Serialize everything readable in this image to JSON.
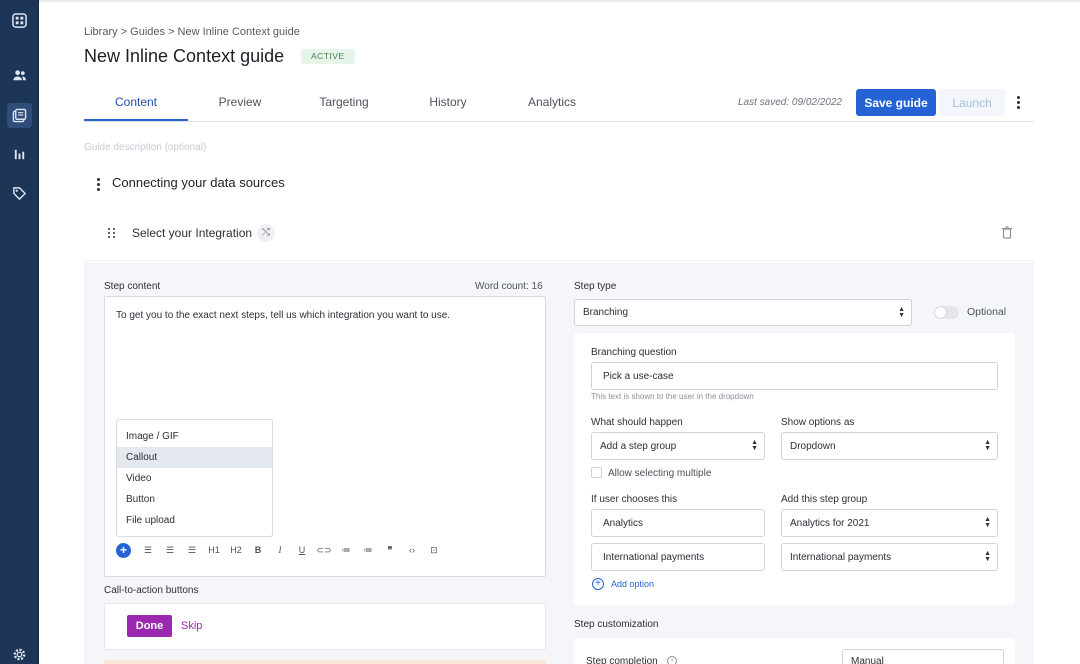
{
  "breadcrumb": "Library > Guides > New Inline Context guide",
  "page_title": "New Inline Context guide",
  "status_badge": "ACTIVE",
  "tabs": [
    {
      "label": "Content"
    },
    {
      "label": "Preview"
    },
    {
      "label": "Targeting"
    },
    {
      "label": "History"
    },
    {
      "label": "Analytics"
    }
  ],
  "last_saved": "Last saved: 09/02/2022",
  "save_label": "Save guide",
  "launch_label": "Launch",
  "guide_description_placeholder": "Guide description (optional)",
  "section_title": "Connecting your data sources",
  "step_title": "Select your Integration",
  "step_content": {
    "label": "Step content",
    "word_count": "Word count: 16",
    "text": "To get you to the exact next steps, tell us which integration you want to use.",
    "insert_menu": [
      "Image / GIF",
      "Callout",
      "Video",
      "Button",
      "File upload"
    ],
    "toolbar": [
      "H1",
      "H2",
      "B",
      "I",
      "U"
    ]
  },
  "cta": {
    "label": "Call-to-action buttons",
    "primary": "Done",
    "secondary": "Skip"
  },
  "step_type": {
    "label": "Step type",
    "value": "Branching",
    "optional_label": "Optional"
  },
  "branching": {
    "question_label": "Branching question",
    "question_value": "Pick a use-case",
    "question_hint": "This text is shown to the user in the dropdown",
    "what_happens_label": "What should happen",
    "what_happens_value": "Add a step group",
    "show_options_label": "Show options as",
    "show_options_value": "Dropdown",
    "allow_multiple_label": "Allow selecting multiple",
    "if_user_label": "If user chooses this",
    "add_group_label": "Add this step group",
    "rows": [
      {
        "choice": "Analytics",
        "group": "Analytics for 2021"
      },
      {
        "choice": "International payments",
        "group": "International payments"
      }
    ],
    "add_option_label": "Add option"
  },
  "customization": {
    "label": "Step customization",
    "completion_label": "Step completion",
    "completion_value": "Manual"
  },
  "colors": {
    "sidebar": "#1d3557",
    "primary": "#2563d4",
    "cta": "#9c27b0"
  },
  "sidebar_icons": [
    "apps-icon",
    "users-icon",
    "guides-icon",
    "analytics-icon",
    "tag-icon",
    "settings-icon"
  ]
}
